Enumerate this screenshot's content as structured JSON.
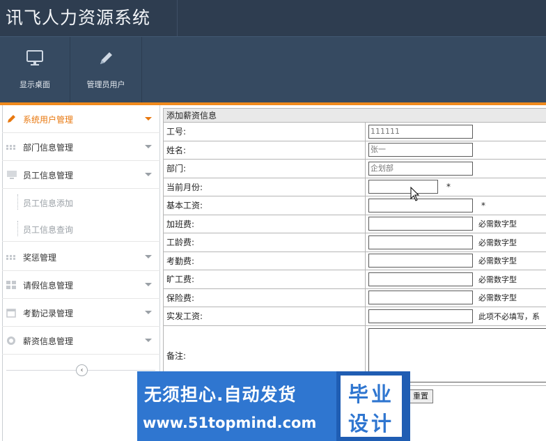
{
  "app": {
    "title": "讯飞人力资源系统"
  },
  "toolbar": [
    {
      "label": "显示桌面",
      "icon": "monitor-icon"
    },
    {
      "label": "管理员用户",
      "icon": "pencil-icon"
    }
  ],
  "sidebar": {
    "items": [
      {
        "label": "系统用户管理",
        "icon": "pencil-icon",
        "active": true
      },
      {
        "label": "部门信息管理",
        "icon": "grid-icon"
      },
      {
        "label": "员工信息管理",
        "icon": "monitor-icon"
      },
      {
        "label": "奖惩管理",
        "icon": "grid-icon"
      },
      {
        "label": "请假信息管理",
        "icon": "columns-icon"
      },
      {
        "label": "考勤记录管理",
        "icon": "calendar-icon"
      },
      {
        "label": "薪资信息管理",
        "icon": "lifebuoy-icon"
      }
    ],
    "subitems": [
      {
        "label": "员工信息添加"
      },
      {
        "label": "员工信息查询"
      }
    ],
    "collapse_glyph": "‹"
  },
  "form": {
    "header": "添加薪资信息",
    "rows": [
      {
        "label": "工号:",
        "value": "111111"
      },
      {
        "label": "姓名:",
        "value": "张一"
      },
      {
        "label": "部门:",
        "value": "企划部"
      },
      {
        "label": "当前月份:",
        "value": "",
        "suffix": "*"
      },
      {
        "label": "基本工资:",
        "value": "",
        "suffix": "*"
      },
      {
        "label": "加班费:",
        "value": "",
        "suffix": "必需数字型"
      },
      {
        "label": "工龄费:",
        "value": "",
        "suffix": "必需数字型"
      },
      {
        "label": "考勤费:",
        "value": "",
        "suffix": "必需数字型"
      },
      {
        "label": "旷工费:",
        "value": "",
        "suffix": "必需数字型"
      },
      {
        "label": "保险费:",
        "value": "",
        "suffix": "必需数字型"
      },
      {
        "label": "实发工资:",
        "value": "",
        "suffix": "此项不必填写，系"
      }
    ],
    "memo_label": "备注:",
    "reset_label": "重置"
  },
  "watermark": {
    "line1": "无须担心.自动发货",
    "line2": "www.51topmind.com",
    "box1": "毕业",
    "box2": "设计"
  }
}
